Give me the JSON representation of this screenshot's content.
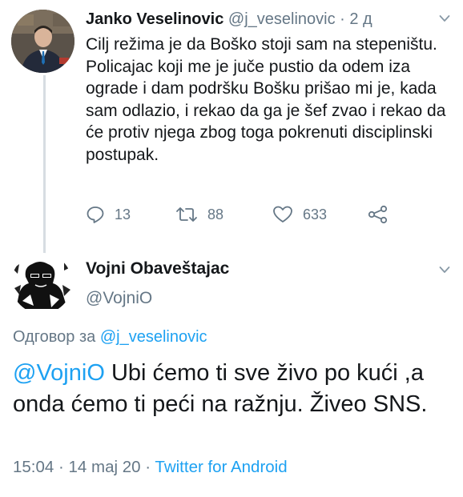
{
  "tweet1": {
    "author_name": "Janko Veselinovic",
    "author_handle": "@j_veselinovic",
    "separator": " · ",
    "time": "2 д",
    "text_lines": [
      "Cilj režima je da Boško stoji sam na stepeništu.",
      "Policajac koji me je juče pustio da odem iza ograde i dam podršku Bošku prišao mi je, kada sam odlazio, i rekao da ga je šef zvao i rekao da će protiv njega zbog toga pokrenuti disciplinski postupak."
    ],
    "reply_count": "13",
    "retweet_count": "88",
    "like_count": "633",
    "icons": [
      "reply-icon",
      "retweet-icon",
      "like-icon",
      "share-icon",
      "chevron-down-icon"
    ]
  },
  "tweet2": {
    "author_name": "Vojni Obaveštajac",
    "author_handle": "@VojniO",
    "reply_prefix": "Одговор за ",
    "reply_handle": "@j_veselinovic",
    "mention": "@VojniO",
    "text_rest": " Ubi ćemo ti sve živo po kući ,a onda ćemo ti  peći na ražnju. Živeo SNS.",
    "time": "15:04",
    "date": "14 maj 20",
    "meta_sep": " · ",
    "client": "Twitter for Android"
  },
  "colors": {
    "link": "#1da1f2",
    "secondary_text": "#657786",
    "thread_line": "#d7dde2"
  }
}
